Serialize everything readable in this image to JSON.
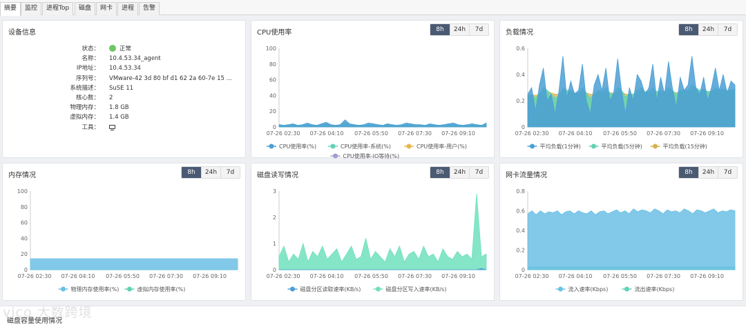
{
  "tabs": [
    {
      "label": "摘要",
      "active": true
    },
    {
      "label": "监控"
    },
    {
      "label": "进程Top"
    },
    {
      "label": "磁盘"
    },
    {
      "label": "网卡"
    },
    {
      "label": "进程"
    },
    {
      "label": "告警"
    }
  ],
  "ranges": [
    "8h",
    "24h",
    "7d"
  ],
  "device": {
    "title": "设备信息",
    "rows": [
      {
        "key": "状态：",
        "value": "正常"
      },
      {
        "key": "名称：",
        "value": "10.4.53.34_agent"
      },
      {
        "key": "IP地址：",
        "value": "10.4.53.34"
      },
      {
        "key": "序列号：",
        "value": "VMware-42 3d 80 bf d1 62 2a 60-7e 15 ..."
      },
      {
        "key": "系统描述：",
        "value": "SuSE 11"
      },
      {
        "key": "核心数：",
        "value": "2"
      },
      {
        "key": "物理内存：",
        "value": "1.8 GB"
      },
      {
        "key": "虚拟内存：",
        "value": "1.4 GB"
      },
      {
        "key": "工具：",
        "value": ""
      }
    ],
    "status_color": "#6ec664"
  },
  "bottom_title": "磁盘容量使用情况",
  "watermark": "vico 大数跨境",
  "chart_data": [
    {
      "id": "cpu",
      "type": "area",
      "title": "CPU使用率",
      "x_ticks": [
        "07-26 02:30",
        "07-26 04:10",
        "07-26 05:50",
        "07-26 07:30",
        "07-26 09:10"
      ],
      "ylim": [
        0,
        100
      ],
      "y_ticks": [
        "0",
        "20",
        "40",
        "60",
        "80",
        "100"
      ],
      "series": [
        {
          "name": "CPU使用率(%)",
          "color": "#4b9fd5",
          "values": [
            3,
            2,
            3,
            4,
            2,
            3,
            5,
            3,
            2,
            4,
            6,
            3,
            2,
            3,
            9,
            4,
            3,
            2,
            3,
            5,
            4,
            3,
            2,
            4,
            3,
            2,
            3,
            5,
            4,
            3,
            3,
            2,
            4,
            3,
            2,
            3,
            4,
            5,
            3,
            2,
            3,
            4,
            3,
            2,
            5
          ]
        },
        {
          "name": "CPU使用率-系统(%)",
          "color": "#5fd3b3",
          "values": [
            2,
            2,
            2,
            3,
            2,
            2,
            3,
            2,
            2,
            3,
            4,
            2,
            2,
            2,
            6,
            3,
            2,
            2,
            2,
            3,
            3,
            2,
            2,
            3,
            2,
            2,
            2,
            3,
            3,
            2,
            2,
            2,
            3,
            2,
            2,
            2,
            3,
            3,
            2,
            2,
            2,
            3,
            2,
            2,
            3
          ]
        },
        {
          "name": "CPU使用率-用户(%)",
          "color": "#e6b84a",
          "values": [
            1,
            1,
            1,
            1,
            1,
            1,
            2,
            1,
            1,
            1,
            2,
            1,
            1,
            1,
            3,
            1,
            1,
            1,
            1,
            2,
            1,
            1,
            1,
            1,
            1,
            1,
            1,
            2,
            1,
            1,
            1,
            1,
            1,
            1,
            1,
            1,
            1,
            2,
            1,
            1,
            1,
            1,
            1,
            1,
            2
          ]
        },
        {
          "name": "CPU使用率-IO等待(%)",
          "color": "#a49cc9",
          "values": [
            0,
            0,
            0,
            0,
            0,
            0,
            0,
            0,
            0,
            0,
            0,
            0,
            0,
            0,
            0,
            0,
            0,
            0,
            0,
            0,
            0,
            0,
            0,
            0,
            0,
            0,
            0,
            0,
            0,
            0,
            0,
            0,
            0,
            0,
            0,
            0,
            0,
            0,
            0,
            0,
            0,
            0,
            0,
            0,
            0
          ]
        }
      ]
    },
    {
      "id": "load",
      "type": "area",
      "title": "负载情况",
      "x_ticks": [
        "07-26 02:30",
        "07-26 04:10",
        "07-26 05:50",
        "07-26 07:30",
        "07-26 09:10"
      ],
      "ylim": [
        0,
        0.6
      ],
      "y_ticks": [
        "0",
        "0.2",
        "0.4",
        "0.6"
      ],
      "series": [
        {
          "name": "平均负载(1分钟)",
          "color": "#4b9fd5",
          "values": [
            0.25,
            0.3,
            0.12,
            0.32,
            0.45,
            0.2,
            0.25,
            0.1,
            0.28,
            0.54,
            0.22,
            0.35,
            0.25,
            0.28,
            0.48,
            0.2,
            0.1,
            0.32,
            0.4,
            0.28,
            0.45,
            0.2,
            0.26,
            0.52,
            0.28,
            0.1,
            0.3,
            0.2,
            0.4,
            0.35,
            0.25,
            0.3,
            0.48,
            0.2,
            0.38,
            0.25,
            0.5,
            0.3,
            0.15,
            0.38,
            0.28,
            0.32,
            0.54,
            0.3,
            0.25,
            0.38,
            0.2,
            0.3,
            0.45,
            0.28,
            0.4,
            0.26,
            0.35,
            0.32
          ]
        },
        {
          "name": "平均负载(5分钟)",
          "color": "#5fd3b3",
          "values": [
            0.22,
            0.25,
            0.22,
            0.25,
            0.3,
            0.28,
            0.25,
            0.22,
            0.24,
            0.3,
            0.28,
            0.28,
            0.26,
            0.26,
            0.3,
            0.26,
            0.22,
            0.25,
            0.28,
            0.27,
            0.3,
            0.26,
            0.25,
            0.3,
            0.28,
            0.23,
            0.25,
            0.25,
            0.28,
            0.3,
            0.27,
            0.27,
            0.3,
            0.27,
            0.28,
            0.27,
            0.3,
            0.28,
            0.25,
            0.28,
            0.28,
            0.28,
            0.32,
            0.3,
            0.28,
            0.29,
            0.27,
            0.27,
            0.3,
            0.28,
            0.29,
            0.28,
            0.28,
            0.29
          ]
        },
        {
          "name": "平均负载(15分钟)",
          "color": "#d8b24e",
          "values": [
            0.24,
            0.25,
            0.24,
            0.25,
            0.27,
            0.27,
            0.26,
            0.25,
            0.25,
            0.27,
            0.27,
            0.27,
            0.26,
            0.26,
            0.27,
            0.26,
            0.25,
            0.25,
            0.26,
            0.26,
            0.27,
            0.26,
            0.26,
            0.27,
            0.27,
            0.25,
            0.25,
            0.25,
            0.26,
            0.27,
            0.27,
            0.26,
            0.27,
            0.26,
            0.27,
            0.26,
            0.27,
            0.27,
            0.26,
            0.27,
            0.27,
            0.27,
            0.28,
            0.28,
            0.27,
            0.28,
            0.27,
            0.27,
            0.28,
            0.27,
            0.28,
            0.27,
            0.27,
            0.28
          ]
        }
      ]
    },
    {
      "id": "mem",
      "type": "area",
      "title": "内存情况",
      "x_ticks": [
        "07-26 02:30",
        "07-26 04:10",
        "07-26 05:50",
        "07-26 07:30",
        "07-26 09:10"
      ],
      "ylim": [
        0,
        100
      ],
      "y_ticks": [
        "0",
        "20",
        "40",
        "60",
        "80",
        "100"
      ],
      "series": [
        {
          "name": "物理内存使用率(%)",
          "color": "#6cc0e5",
          "values": [
            14,
            14,
            14,
            14,
            14,
            14,
            14,
            14,
            14,
            14
          ]
        },
        {
          "name": "虚拟内存使用率(%)",
          "color": "#5fd3b3",
          "values": [
            0,
            0,
            0,
            0,
            0,
            0,
            0,
            0,
            0,
            0
          ]
        }
      ]
    },
    {
      "id": "disk",
      "type": "area",
      "title": "磁盘读写情况",
      "x_ticks": [
        "07-26 02:30",
        "07-26 04:10",
        "07-26 05:50",
        "07-26 07:30",
        "07-26 09:10"
      ],
      "ylim": [
        0,
        3
      ],
      "y_ticks": [
        "0",
        "1",
        "2",
        "3"
      ],
      "series": [
        {
          "name": "磁盘分区读取速率(KB/s)",
          "color": "#4b9fd5",
          "values": [
            0,
            0,
            0,
            0,
            0,
            0,
            0,
            0,
            0,
            0,
            0,
            0,
            0,
            0,
            0,
            0,
            0,
            0,
            0,
            0,
            0,
            0,
            0,
            0,
            0,
            0,
            0,
            0,
            0,
            0,
            0,
            0,
            0,
            0,
            0,
            0,
            0,
            0,
            0,
            0,
            0,
            0.05,
            0
          ]
        },
        {
          "name": "磁盘分区写入速率(KB/s)",
          "color": "#6fe0bd",
          "values": [
            0.5,
            0.9,
            0.3,
            0.6,
            0.4,
            1.0,
            0.3,
            0.7,
            0.5,
            0.9,
            0.4,
            0.6,
            0.8,
            0.3,
            0.6,
            0.9,
            0.4,
            0.5,
            1.2,
            0.4,
            0.7,
            0.5,
            0.3,
            0.8,
            0.5,
            0.9,
            0.3,
            0.6,
            0.7,
            0.4,
            0.9,
            0.5,
            0.6,
            0.3,
            0.8,
            0.5,
            0.4,
            0.7,
            0.5,
            0.6,
            0.4,
            2.9,
            0.5,
            0.6
          ]
        }
      ]
    },
    {
      "id": "net",
      "type": "area",
      "title": "网卡流量情况",
      "x_ticks": [
        "07-26 02:30",
        "07-26 04:10",
        "07-26 05:50",
        "07-26 07:30",
        "07-26 09:10"
      ],
      "ylim": [
        0,
        0.8
      ],
      "y_ticks": [
        "0",
        "0.2",
        "0.4",
        "0.6",
        "0.8"
      ],
      "series": [
        {
          "name": "流入速率(Kbps)",
          "color": "#6cc0e5",
          "values": [
            0.57,
            0.6,
            0.56,
            0.6,
            0.57,
            0.59,
            0.58,
            0.6,
            0.56,
            0.59,
            0.6,
            0.57,
            0.6,
            0.58,
            0.57,
            0.6,
            0.56,
            0.59,
            0.6,
            0.57,
            0.59,
            0.61,
            0.58,
            0.6,
            0.57,
            0.62,
            0.59,
            0.61,
            0.6,
            0.58,
            0.62,
            0.6,
            0.57,
            0.61,
            0.59,
            0.6,
            0.58,
            0.62,
            0.6,
            0.57,
            0.61,
            0.6,
            0.58,
            0.6,
            0.62,
            0.58,
            0.6,
            0.59,
            0.61,
            0.6
          ]
        },
        {
          "name": "流出速率(Kbps)",
          "color": "#5fd3b3",
          "values": [
            0.03,
            0.03,
            0.03,
            0.03,
            0.03,
            0.03,
            0.03,
            0.03,
            0.03,
            0.03,
            0.03,
            0.03,
            0.03,
            0.03,
            0.03,
            0.03,
            0.03,
            0.03,
            0.03,
            0.03,
            0.03,
            0.03,
            0.03,
            0.03,
            0.03,
            0.03,
            0.03,
            0.03,
            0.03,
            0.03,
            0.03,
            0.03,
            0.03,
            0.03,
            0.03,
            0.03,
            0.03,
            0.03,
            0.03,
            0.03,
            0.03,
            0.03,
            0.03,
            0.03,
            0.03,
            0.03,
            0.03,
            0.03,
            0.03,
            0.03
          ]
        }
      ]
    }
  ]
}
